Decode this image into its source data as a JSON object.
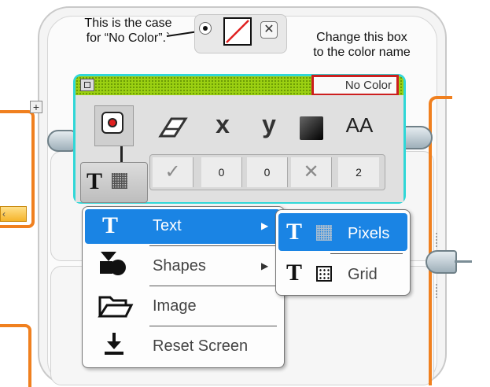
{
  "annotations": {
    "no_color_note_line1": "This is the case",
    "no_color_note_line2": "for “No Color”.`",
    "change_box_note_line1": "Change this box",
    "change_box_note_line2": "to the color name"
  },
  "block": {
    "color_name": "No Color",
    "params": {
      "fill_check": "✓",
      "x": "0",
      "y": "0",
      "color_x": "✕",
      "font": "2"
    },
    "param_icons": [
      "eraser-icon",
      "x-icon",
      "y-icon",
      "color-square-icon",
      "font-size-icon"
    ],
    "x_label": "x",
    "y_label": "y",
    "font_label": "AA"
  },
  "mode_menu": {
    "items": [
      {
        "label": "Text",
        "icon": "text-t-icon",
        "active": true,
        "has_submenu": true
      },
      {
        "label": "Shapes",
        "icon": "shapes-icon",
        "active": false,
        "has_submenu": true
      },
      {
        "label": "Image",
        "icon": "folder-icon",
        "active": false,
        "has_submenu": false
      },
      {
        "label": "Reset Screen",
        "icon": "reset-screen-icon",
        "active": false,
        "has_submenu": false
      }
    ]
  },
  "text_submenu": {
    "items": [
      {
        "label": "Pixels",
        "active": true
      },
      {
        "label": "Grid",
        "active": false
      }
    ]
  },
  "misc": {
    "plus_label": "+",
    "close_label": "✕",
    "t_glyph": "T",
    "arrow_glyph": "▶"
  },
  "colors": {
    "accent_blue": "#1a84e4",
    "block_header_green": "#9bd012",
    "highlight_red": "#cc1e1e",
    "block_border_cyan": "#30d7d7",
    "wire_orange": "#f0801f"
  }
}
